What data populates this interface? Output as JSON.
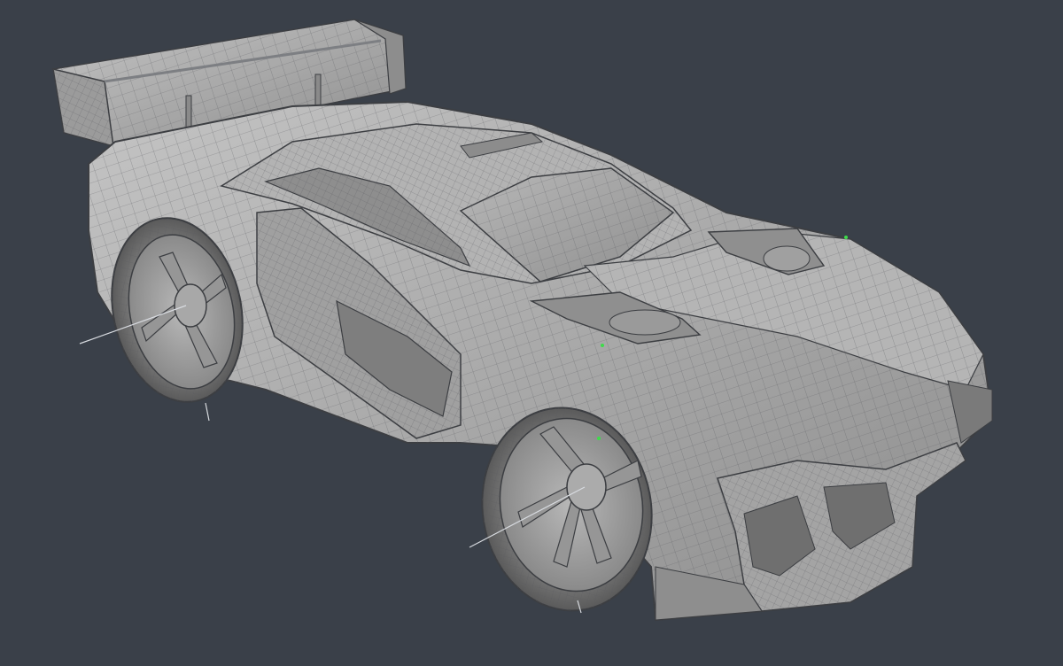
{
  "viewport": {
    "background_color": "#3a4049",
    "model_color": "#a8a8a8",
    "model_shadow_color": "#6f7176",
    "model_highlight_color": "#d2d2d2",
    "wire_color": "#5a5c60",
    "edge_color": "#3c3e42",
    "locator_color": "#3ddc4a",
    "pivot_line_color": "#d8dbe0"
  },
  "model": {
    "object": "sports-car-subdivision-mesh",
    "display_mode": "wireframe-on-shaded"
  }
}
